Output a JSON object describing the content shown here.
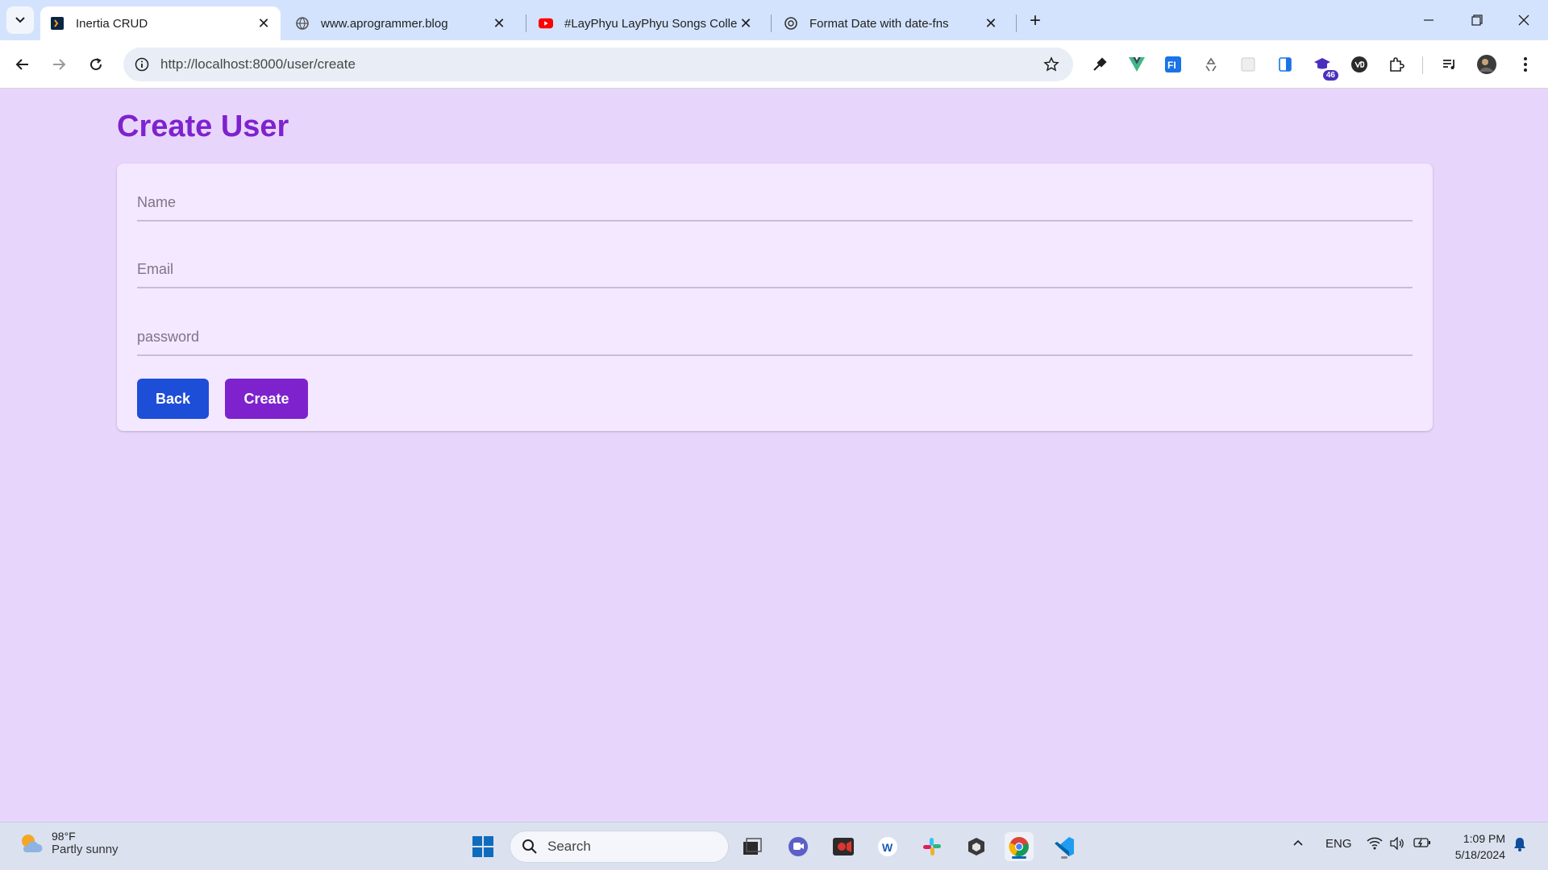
{
  "browser": {
    "tabs": [
      {
        "title": "Inertia CRUD",
        "active": true
      },
      {
        "title": "www.aprogrammer.blog",
        "active": false
      },
      {
        "title": "#LayPhyu LayPhyu Songs Colle",
        "active": false
      },
      {
        "title": "Format Date with date-fns",
        "active": false
      }
    ],
    "url": "http://localhost:8000/user/create",
    "extension_badge": "46"
  },
  "page": {
    "title": "Create User",
    "form": {
      "name_placeholder": "Name",
      "email_placeholder": "Email",
      "password_placeholder": "password",
      "back_label": "Back",
      "create_label": "Create"
    }
  },
  "taskbar": {
    "weather_temp": "98°F",
    "weather_condition": "Partly sunny",
    "search_label": "Search",
    "language": "ENG",
    "time": "1:09 PM",
    "date": "5/18/2024"
  },
  "colors": {
    "page_bg": "#e8d5fb",
    "card_bg": "#f3e8ff",
    "title": "#7e22ce",
    "back_button": "#1d4ed8",
    "create_button": "#7e22ce"
  }
}
